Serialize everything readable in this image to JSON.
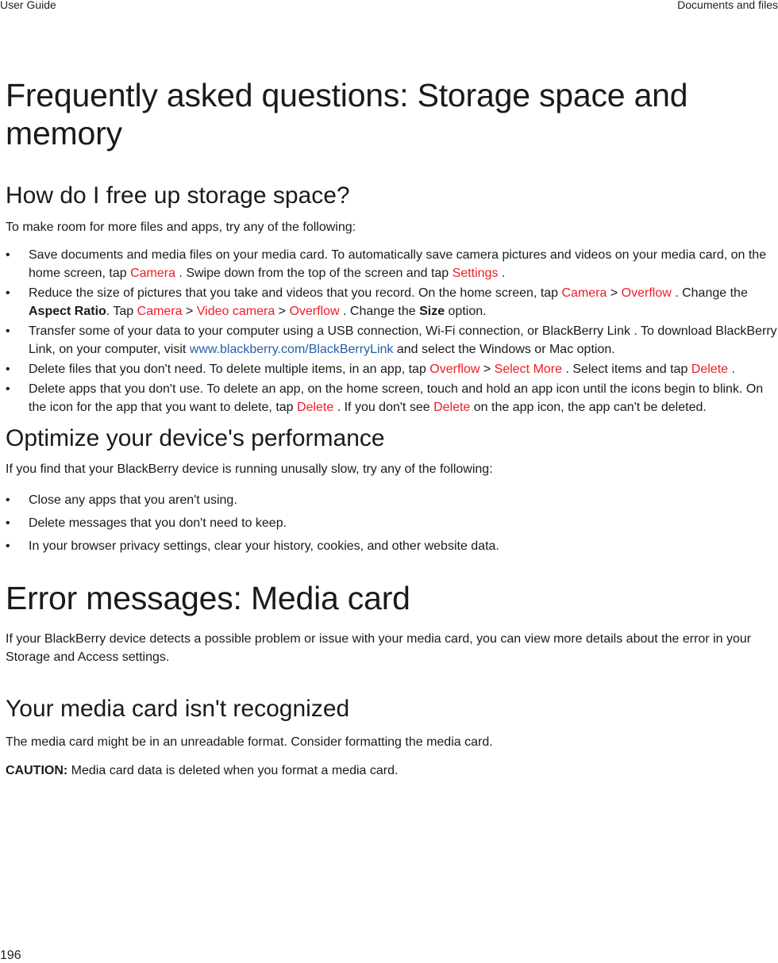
{
  "header": {
    "left": "User Guide",
    "right": "Documents and files"
  },
  "sections": {
    "faq": {
      "title": "Frequently asked questions: Storage space and memory",
      "free_space": {
        "heading": "How do I free up storage space?",
        "intro": "To make room for more files and apps, try any of the following:",
        "b1": {
          "t1": "Save documents and media files on your media card. To automatically save camera pictures and videos on your media card, on the home screen, tap ",
          "ui1": "Camera",
          "t2": " . Swipe down from the top of the screen and tap ",
          "ui2": "Settings",
          "t3": " ."
        },
        "b2": {
          "t1": "Reduce the size of pictures that you take and videos that you record. On the home screen, tap ",
          "ui1": "Camera",
          "sep1": " > ",
          "ui2": "Overflow",
          "t2": " . Change the ",
          "bold1": "Aspect Ratio",
          "t3": ". Tap ",
          "ui3": "Camera",
          "sep2": " > ",
          "ui4": "Video camera",
          "sep3": " > ",
          "ui5": "Overflow",
          "t4": " . Change the ",
          "bold2": "Size",
          "t5": " option."
        },
        "b3": {
          "t1": "Transfer some of your data to your computer using a USB connection, Wi-Fi connection, or BlackBerry Link . To download BlackBerry Link, on your computer, visit ",
          "link": "www.blackberry.com/BlackBerryLink",
          "t2": " and select the Windows or Mac option."
        },
        "b4": {
          "t1": "Delete files that you don't need. To delete multiple items, in an app, tap ",
          "ui1": "Overflow",
          "sep1": " > ",
          "ui2": "Select More",
          "t2": " . Select items and tap ",
          "ui3": "Delete",
          "t3": " ."
        },
        "b5": {
          "t1": "Delete apps that you don't use. To delete an app, on the home screen, touch and hold an app icon until the icons begin to blink. On the icon for the app that you want to delete, tap ",
          "ui1": "Delete",
          "t2": " . If you don't see ",
          "ui2": "Delete",
          "t3": " on the app icon, the app can't be deleted."
        }
      },
      "performance": {
        "heading": "Optimize your device's performance",
        "intro": "If you find that your BlackBerry device is running unusally slow, try any of the following:",
        "items": [
          "Close any apps that you aren't using.",
          "Delete messages that you don't need to keep.",
          "In your browser privacy settings, clear your history, cookies, and other website data."
        ]
      }
    },
    "errors": {
      "title": "Error messages: Media card",
      "intro": "If your BlackBerry device detects a possible problem or issue with your media card, you can view more details about the error in your Storage and Access settings.",
      "not_recognized": {
        "heading": "Your media card isn't recognized",
        "text": "The media card might be in an unreadable format. Consider formatting the media card.",
        "caution_label": "CAUTION:",
        "caution_text": " Media card data is deleted when you format a media card."
      }
    }
  },
  "footer": {
    "page_number": "196"
  }
}
